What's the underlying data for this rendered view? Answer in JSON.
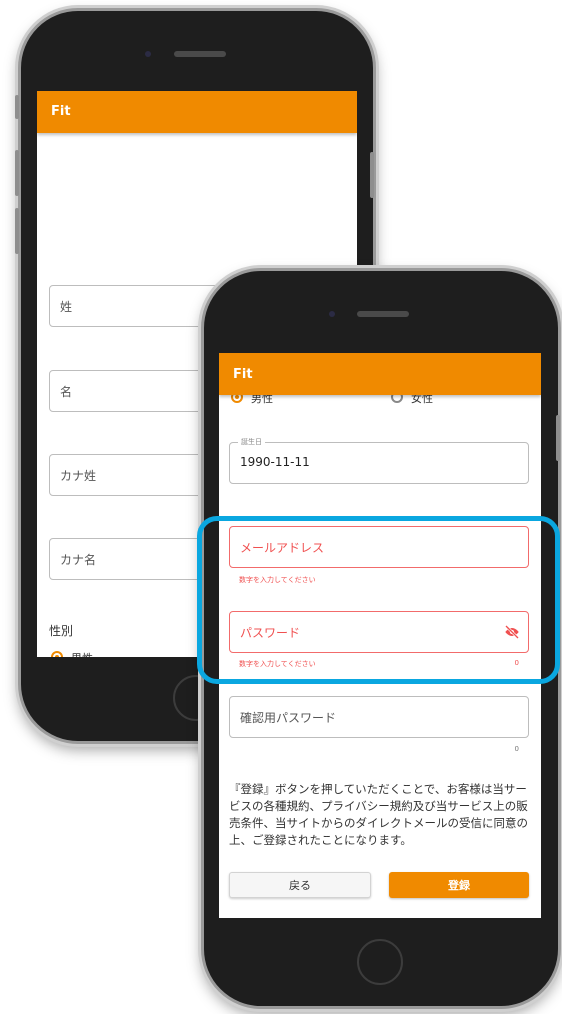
{
  "back_phone": {
    "app_title": "Fit",
    "fields": {
      "last_name": "姓",
      "first_name": "名",
      "kana_last": "カナ姓",
      "kana_first": "カナ名"
    },
    "gender_label": "性別",
    "gender_male_partial": "男性"
  },
  "front_phone": {
    "app_title": "Fit",
    "gender": {
      "male": "男性",
      "female": "女性",
      "selected": "male"
    },
    "birthday": {
      "label": "誕生日",
      "value": "1990-11-11"
    },
    "email": {
      "placeholder": "メールアドレス",
      "error": "数字を入力してください"
    },
    "password": {
      "placeholder": "パスワード",
      "error": "数字を入力してください",
      "counter": "0"
    },
    "confirm_password": {
      "placeholder": "確認用パスワード",
      "counter": "0"
    },
    "notice": "『登録』ボタンを押していただくことで、お客様は当サービスの各種規約、プライバシー規約及び当サービス上の販売条件、当サイトからのダイレクトメールの受信に同意の上、ご登録されたことになります。",
    "buttons": {
      "back": "戻る",
      "register": "登録"
    }
  },
  "colors": {
    "accent": "#f08a00",
    "error": "#f05050",
    "highlight": "#0aa7e0",
    "phone_body": "#1e1e1e"
  },
  "icons": {
    "password_toggle": "eye-off-icon"
  }
}
